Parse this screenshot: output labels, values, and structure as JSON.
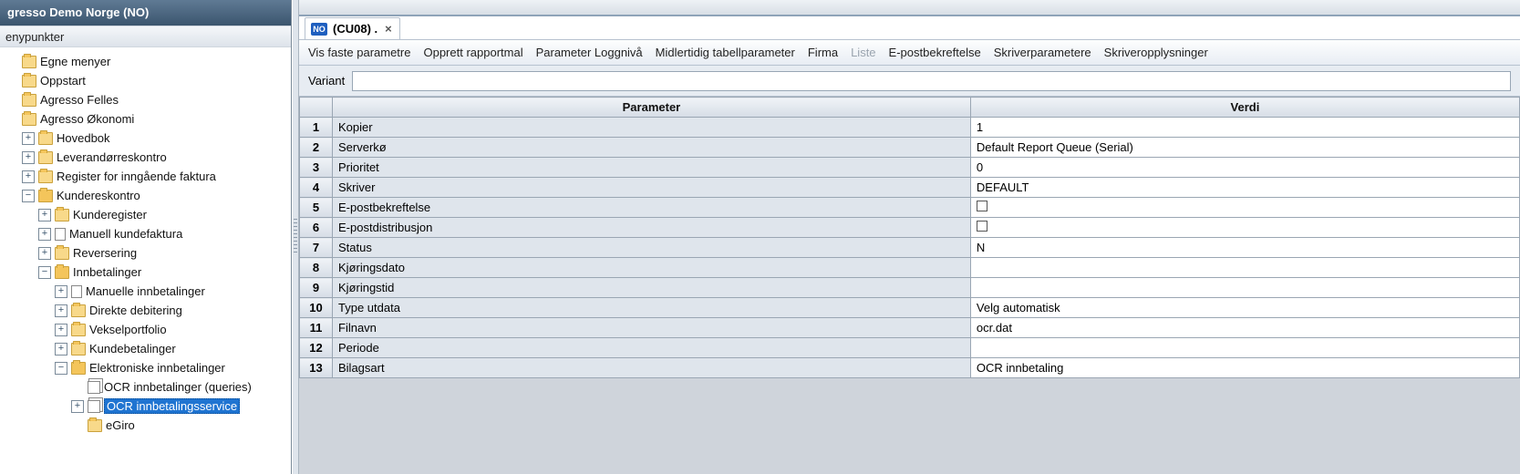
{
  "sidebar": {
    "title": "gresso Demo Norge (NO)",
    "panel_header": "enypunkter",
    "tree": [
      {
        "depth": 0,
        "expander": "blank",
        "icon": "folder-closed",
        "label": "Egne menyer"
      },
      {
        "depth": 0,
        "expander": "blank",
        "icon": "folder-closed",
        "label": "Oppstart"
      },
      {
        "depth": 0,
        "expander": "blank",
        "icon": "folder-closed",
        "label": "Agresso Felles"
      },
      {
        "depth": 0,
        "expander": "blank",
        "icon": "folder-closed",
        "label": "Agresso Økonomi"
      },
      {
        "depth": 1,
        "expander": "plus",
        "icon": "folder-closed",
        "label": "Hovedbok"
      },
      {
        "depth": 1,
        "expander": "plus",
        "icon": "folder-closed",
        "label": "Leverandørreskontro"
      },
      {
        "depth": 1,
        "expander": "plus",
        "icon": "folder-closed",
        "label": "Register for inngående faktura"
      },
      {
        "depth": 1,
        "expander": "minus",
        "icon": "folder-open",
        "label": "Kundereskontro"
      },
      {
        "depth": 2,
        "expander": "plus",
        "icon": "folder-closed",
        "label": "Kunderegister"
      },
      {
        "depth": 2,
        "expander": "plus",
        "icon": "page",
        "label": "Manuell kundefaktura"
      },
      {
        "depth": 2,
        "expander": "plus",
        "icon": "folder-closed",
        "label": "Reversering"
      },
      {
        "depth": 2,
        "expander": "minus",
        "icon": "folder-open",
        "label": "Innbetalinger"
      },
      {
        "depth": 3,
        "expander": "plus",
        "icon": "page",
        "label": "Manuelle innbetalinger"
      },
      {
        "depth": 3,
        "expander": "plus",
        "icon": "folder-closed",
        "label": "Direkte debitering"
      },
      {
        "depth": 3,
        "expander": "plus",
        "icon": "folder-closed",
        "label": "Vekselportfolio"
      },
      {
        "depth": 3,
        "expander": "plus",
        "icon": "folder-closed",
        "label": "Kundebetalinger"
      },
      {
        "depth": 3,
        "expander": "minus",
        "icon": "folder-open",
        "label": "Elektroniske innbetalinger"
      },
      {
        "depth": 4,
        "expander": "blank",
        "icon": "pages",
        "label": "OCR innbetalinger (queries)"
      },
      {
        "depth": 4,
        "expander": "plus",
        "icon": "pages",
        "label": "OCR innbetalingsservice",
        "selected": true
      },
      {
        "depth": 4,
        "expander": "blank",
        "icon": "folder-closed",
        "label": "eGiro"
      }
    ]
  },
  "tab": {
    "badge": "NO",
    "title": "(CU08) .",
    "close": "×"
  },
  "menu": {
    "items": [
      {
        "label": "Vis faste parametre",
        "disabled": false
      },
      {
        "label": "Opprett rapportmal",
        "disabled": false
      },
      {
        "label": "Parameter Loggnivå",
        "disabled": false
      },
      {
        "label": "Midlertidig tabellparameter",
        "disabled": false
      },
      {
        "label": "Firma",
        "disabled": false
      },
      {
        "label": "Liste",
        "disabled": true
      },
      {
        "label": "E-postbekreftelse",
        "disabled": false
      },
      {
        "label": "Skriverparametere",
        "disabled": false
      },
      {
        "label": "Skriveropplysninger",
        "disabled": false
      }
    ]
  },
  "variant": {
    "label": "Variant",
    "value": ""
  },
  "grid": {
    "headers": {
      "row": "",
      "param": "Parameter",
      "value": "Verdi"
    },
    "rows": [
      {
        "n": "1",
        "param": "Kopier",
        "value": "1",
        "type": "text"
      },
      {
        "n": "2",
        "param": "Serverkø",
        "value": "Default Report Queue (Serial)",
        "type": "text"
      },
      {
        "n": "3",
        "param": "Prioritet",
        "value": "0",
        "type": "text"
      },
      {
        "n": "4",
        "param": "Skriver",
        "value": "DEFAULT",
        "type": "text"
      },
      {
        "n": "5",
        "param": "E-postbekreftelse",
        "value": "",
        "type": "checkbox"
      },
      {
        "n": "6",
        "param": "E-postdistribusjon",
        "value": "",
        "type": "checkbox"
      },
      {
        "n": "7",
        "param": "Status",
        "value": "N",
        "type": "text"
      },
      {
        "n": "8",
        "param": "Kjøringsdato",
        "value": "",
        "type": "text"
      },
      {
        "n": "9",
        "param": "Kjøringstid",
        "value": "",
        "type": "text"
      },
      {
        "n": "10",
        "param": "Type utdata",
        "value": "Velg automatisk",
        "type": "text"
      },
      {
        "n": "11",
        "param": "Filnavn",
        "value": "ocr.dat",
        "type": "text"
      },
      {
        "n": "12",
        "param": "Periode",
        "value": "",
        "type": "text"
      },
      {
        "n": "13",
        "param": "Bilagsart",
        "value": "OCR innbetaling",
        "type": "text"
      }
    ]
  }
}
